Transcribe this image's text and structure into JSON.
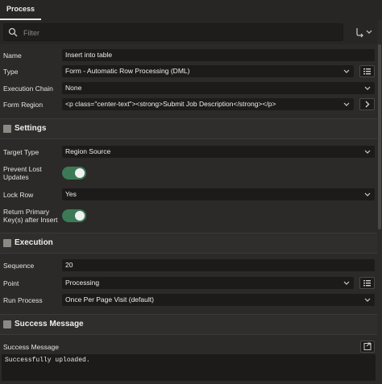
{
  "tabs": [
    {
      "label": "Process"
    }
  ],
  "search": {
    "placeholder": "Filter"
  },
  "fields": {
    "name": {
      "label": "Name",
      "value": "Insert into table"
    },
    "type": {
      "label": "Type",
      "value": "Form - Automatic Row Processing (DML)"
    },
    "execution_chain": {
      "label": "Execution Chain",
      "value": "None"
    },
    "form_region": {
      "label": "Form Region",
      "value": "<p class=\"center-text\"><strong>Submit Job Description</strong></p>"
    }
  },
  "settings": {
    "title": "Settings",
    "target_type": {
      "label": "Target Type",
      "value": "Region Source"
    },
    "prevent_lost_updates": {
      "label_line1": "Prevent Lost",
      "label_line2": "Updates",
      "on": true
    },
    "lock_row": {
      "label": "Lock Row",
      "value": "Yes"
    },
    "return_primary_key": {
      "label_line1": "Return Primary",
      "label_line2": "Key(s) after Insert",
      "on": true
    }
  },
  "execution": {
    "title": "Execution",
    "sequence": {
      "label": "Sequence",
      "value": "20"
    },
    "point": {
      "label": "Point",
      "value": "Processing"
    },
    "run_process": {
      "label": "Run Process",
      "value": "Once Per Page Visit (default)"
    }
  },
  "success": {
    "title": "Success Message",
    "label": "Success Message",
    "value": "Successfully uploaded."
  },
  "colors": {
    "toggle_on": "#3c7a55",
    "background": "#2b2a28",
    "field": "#1c1b19"
  },
  "icons": [
    "search-icon",
    "filter-menu-icon",
    "chevron-down-icon",
    "list-icon",
    "chevron-right-icon",
    "expand-icon",
    "checkbox-icon"
  ]
}
